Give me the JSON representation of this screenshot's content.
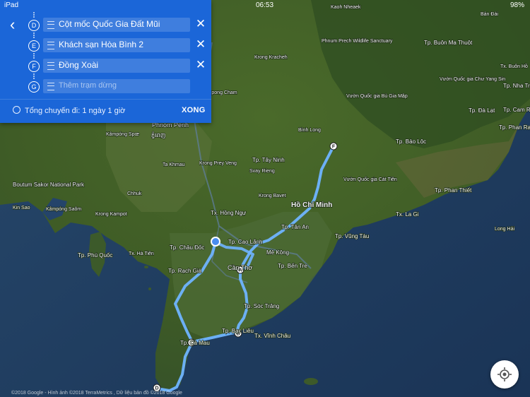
{
  "status_bar": {
    "device": "iPad",
    "time": "06:53",
    "battery": "98%"
  },
  "directions_panel": {
    "stops": [
      {
        "letter": "D",
        "name": "Cột mốc Quốc Gia Đất Mũi"
      },
      {
        "letter": "E",
        "name": "Khách sạn Hòa Bình 2"
      },
      {
        "letter": "F",
        "name": "Đồng Xoài"
      },
      {
        "letter": "G",
        "placeholder": "Thêm trạm dừng"
      }
    ],
    "summary": "Tổng chuyến đi: 1 ngày 1 giờ",
    "done_label": "XONG"
  },
  "map": {
    "attribution": "©2018 Google - Hình ảnh ©2018 TerraMetrics , Dữ liệu bản đồ ©2018 Google",
    "route_color": "#6fb4ff",
    "waypoint_markers": [
      "A",
      "B",
      "C",
      "D",
      "F"
    ],
    "places": [
      {
        "id": "phnom-penh",
        "text": "Phnom Penh"
      },
      {
        "id": "phnom-penh-kh",
        "text": "ភ្នំពេញ"
      },
      {
        "id": "kampong-cham",
        "text": "Kampong Cham"
      },
      {
        "id": "krong-kracheh",
        "text": "Krong Kracheh"
      },
      {
        "id": "kaoh-nheaek",
        "text": "Kaoh Nheaek"
      },
      {
        "id": "phnum-prech",
        "text": "Phnum Prech Wildlife Sanctuary"
      },
      {
        "id": "ban-dai",
        "text": "Bản Đài"
      },
      {
        "id": "tp-buon-ma-thuot",
        "text": "Tp. Buôn Ma Thuột"
      },
      {
        "id": "tx-buon-ho",
        "text": "Tx. Buôn Hồ"
      },
      {
        "id": "tp-nha-trang",
        "text": "Tp. Nha Trang"
      },
      {
        "id": "vuon-quoc-gia-chu-yang-sin",
        "text": "Vườn Quốc gia Chư Yang Sin"
      },
      {
        "id": "vuon-quoc-gia-bu-gia-map",
        "text": "Vườn Quốc gia Bù Gia Mập"
      },
      {
        "id": "tp-da-lat",
        "text": "Tp. Đà Lạt"
      },
      {
        "id": "tp-cam-ranh",
        "text": "Tp. Cam Ranh"
      },
      {
        "id": "tp-phan-rang",
        "text": "Tp. Phan Rang Tháp Chàm"
      },
      {
        "id": "tp-bao-loc",
        "text": "Tp. Bảo Lộc"
      },
      {
        "id": "binh-long",
        "text": "Bình Long"
      },
      {
        "id": "tp-tay-ninh",
        "text": "Tp. Tây Ninh"
      },
      {
        "id": "svay-rieng",
        "text": "Svay Rieng"
      },
      {
        "id": "kong-bavet",
        "text": "Krong Bavet"
      },
      {
        "id": "ho-chi-minh",
        "text": "Hồ Chí Minh"
      },
      {
        "id": "vuon-quoc-gia-cat-tien",
        "text": "Vườn Quốc gia Cát Tiên"
      },
      {
        "id": "tp-phan-thiet",
        "text": "Tp. Phan Thiết"
      },
      {
        "id": "tp-tan-an",
        "text": "Tp. Tân An"
      },
      {
        "id": "tp-vung-tau",
        "text": "Tp. Vũng Tàu"
      },
      {
        "id": "tx-la-gi",
        "text": "Tx. La Gi"
      },
      {
        "id": "long-hai",
        "text": "Long Hải"
      },
      {
        "id": "tp-cao-lanh",
        "text": "Tp. Cao Lãnh"
      },
      {
        "id": "me-kong",
        "text": "Mê Kông"
      },
      {
        "id": "tp-ben-tre",
        "text": "Tp. Bến Tre"
      },
      {
        "id": "can-tho",
        "text": "Cần Thơ"
      },
      {
        "id": "tp-soc-trang",
        "text": "Tp. Sóc Trăng"
      },
      {
        "id": "tp-bac-lieu",
        "text": "Tp. Bạc Liêu"
      },
      {
        "id": "tx-vinh-chau",
        "text": "Tx. Vĩnh Châu"
      },
      {
        "id": "tp-ca-mau",
        "text": "Tp. Cà Mau"
      },
      {
        "id": "tp-chau-doc",
        "text": "Tp. Châu Đốc"
      },
      {
        "id": "tp-rach-gia",
        "text": "Tp. Rạch Giá"
      },
      {
        "id": "tx-ha-tien",
        "text": "Tx. Hà Tiên"
      },
      {
        "id": "tp-phu-quoc",
        "text": "Tp. Phú Quốc"
      },
      {
        "id": "tx-hong-ngu",
        "text": "Tx. Hồng Ngự"
      },
      {
        "id": "kampong-trach",
        "text": "Krong Kampot"
      },
      {
        "id": "chhuk",
        "text": "Chhuk"
      },
      {
        "id": "kampong-speu",
        "text": "Kâmpóng Spœ"
      },
      {
        "id": "ta-khmau",
        "text": "Ta Khmau"
      },
      {
        "id": "krong-prey-veng",
        "text": "Krong Prey Veng"
      },
      {
        "id": "boutum-sakor",
        "text": "Boutum Sakor National Park"
      },
      {
        "id": "kim-pong-sao",
        "text": "Kâmpóng Saôm"
      },
      {
        "id": "kin-sao",
        "text": "Kin Sao"
      }
    ]
  }
}
